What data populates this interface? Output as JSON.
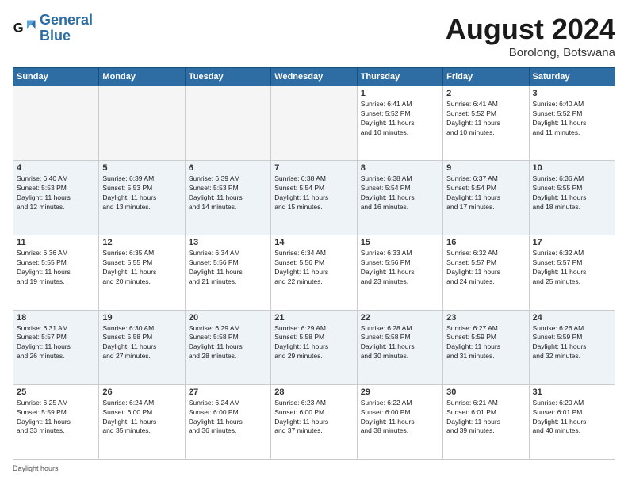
{
  "header": {
    "logo_line1": "General",
    "logo_line2": "Blue",
    "month_title": "August 2024",
    "location": "Borolong, Botswana"
  },
  "days_of_week": [
    "Sunday",
    "Monday",
    "Tuesday",
    "Wednesday",
    "Thursday",
    "Friday",
    "Saturday"
  ],
  "weeks": [
    [
      {
        "day": "",
        "info": ""
      },
      {
        "day": "",
        "info": ""
      },
      {
        "day": "",
        "info": ""
      },
      {
        "day": "",
        "info": ""
      },
      {
        "day": "1",
        "info": "Sunrise: 6:41 AM\nSunset: 5:52 PM\nDaylight: 11 hours\nand 10 minutes."
      },
      {
        "day": "2",
        "info": "Sunrise: 6:41 AM\nSunset: 5:52 PM\nDaylight: 11 hours\nand 10 minutes."
      },
      {
        "day": "3",
        "info": "Sunrise: 6:40 AM\nSunset: 5:52 PM\nDaylight: 11 hours\nand 11 minutes."
      }
    ],
    [
      {
        "day": "4",
        "info": "Sunrise: 6:40 AM\nSunset: 5:53 PM\nDaylight: 11 hours\nand 12 minutes."
      },
      {
        "day": "5",
        "info": "Sunrise: 6:39 AM\nSunset: 5:53 PM\nDaylight: 11 hours\nand 13 minutes."
      },
      {
        "day": "6",
        "info": "Sunrise: 6:39 AM\nSunset: 5:53 PM\nDaylight: 11 hours\nand 14 minutes."
      },
      {
        "day": "7",
        "info": "Sunrise: 6:38 AM\nSunset: 5:54 PM\nDaylight: 11 hours\nand 15 minutes."
      },
      {
        "day": "8",
        "info": "Sunrise: 6:38 AM\nSunset: 5:54 PM\nDaylight: 11 hours\nand 16 minutes."
      },
      {
        "day": "9",
        "info": "Sunrise: 6:37 AM\nSunset: 5:54 PM\nDaylight: 11 hours\nand 17 minutes."
      },
      {
        "day": "10",
        "info": "Sunrise: 6:36 AM\nSunset: 5:55 PM\nDaylight: 11 hours\nand 18 minutes."
      }
    ],
    [
      {
        "day": "11",
        "info": "Sunrise: 6:36 AM\nSunset: 5:55 PM\nDaylight: 11 hours\nand 19 minutes."
      },
      {
        "day": "12",
        "info": "Sunrise: 6:35 AM\nSunset: 5:55 PM\nDaylight: 11 hours\nand 20 minutes."
      },
      {
        "day": "13",
        "info": "Sunrise: 6:34 AM\nSunset: 5:56 PM\nDaylight: 11 hours\nand 21 minutes."
      },
      {
        "day": "14",
        "info": "Sunrise: 6:34 AM\nSunset: 5:56 PM\nDaylight: 11 hours\nand 22 minutes."
      },
      {
        "day": "15",
        "info": "Sunrise: 6:33 AM\nSunset: 5:56 PM\nDaylight: 11 hours\nand 23 minutes."
      },
      {
        "day": "16",
        "info": "Sunrise: 6:32 AM\nSunset: 5:57 PM\nDaylight: 11 hours\nand 24 minutes."
      },
      {
        "day": "17",
        "info": "Sunrise: 6:32 AM\nSunset: 5:57 PM\nDaylight: 11 hours\nand 25 minutes."
      }
    ],
    [
      {
        "day": "18",
        "info": "Sunrise: 6:31 AM\nSunset: 5:57 PM\nDaylight: 11 hours\nand 26 minutes."
      },
      {
        "day": "19",
        "info": "Sunrise: 6:30 AM\nSunset: 5:58 PM\nDaylight: 11 hours\nand 27 minutes."
      },
      {
        "day": "20",
        "info": "Sunrise: 6:29 AM\nSunset: 5:58 PM\nDaylight: 11 hours\nand 28 minutes."
      },
      {
        "day": "21",
        "info": "Sunrise: 6:29 AM\nSunset: 5:58 PM\nDaylight: 11 hours\nand 29 minutes."
      },
      {
        "day": "22",
        "info": "Sunrise: 6:28 AM\nSunset: 5:58 PM\nDaylight: 11 hours\nand 30 minutes."
      },
      {
        "day": "23",
        "info": "Sunrise: 6:27 AM\nSunset: 5:59 PM\nDaylight: 11 hours\nand 31 minutes."
      },
      {
        "day": "24",
        "info": "Sunrise: 6:26 AM\nSunset: 5:59 PM\nDaylight: 11 hours\nand 32 minutes."
      }
    ],
    [
      {
        "day": "25",
        "info": "Sunrise: 6:25 AM\nSunset: 5:59 PM\nDaylight: 11 hours\nand 33 minutes."
      },
      {
        "day": "26",
        "info": "Sunrise: 6:24 AM\nSunset: 6:00 PM\nDaylight: 11 hours\nand 35 minutes."
      },
      {
        "day": "27",
        "info": "Sunrise: 6:24 AM\nSunset: 6:00 PM\nDaylight: 11 hours\nand 36 minutes."
      },
      {
        "day": "28",
        "info": "Sunrise: 6:23 AM\nSunset: 6:00 PM\nDaylight: 11 hours\nand 37 minutes."
      },
      {
        "day": "29",
        "info": "Sunrise: 6:22 AM\nSunset: 6:00 PM\nDaylight: 11 hours\nand 38 minutes."
      },
      {
        "day": "30",
        "info": "Sunrise: 6:21 AM\nSunset: 6:01 PM\nDaylight: 11 hours\nand 39 minutes."
      },
      {
        "day": "31",
        "info": "Sunrise: 6:20 AM\nSunset: 6:01 PM\nDaylight: 11 hours\nand 40 minutes."
      }
    ]
  ],
  "footer": {
    "daylight_label": "Daylight hours"
  }
}
